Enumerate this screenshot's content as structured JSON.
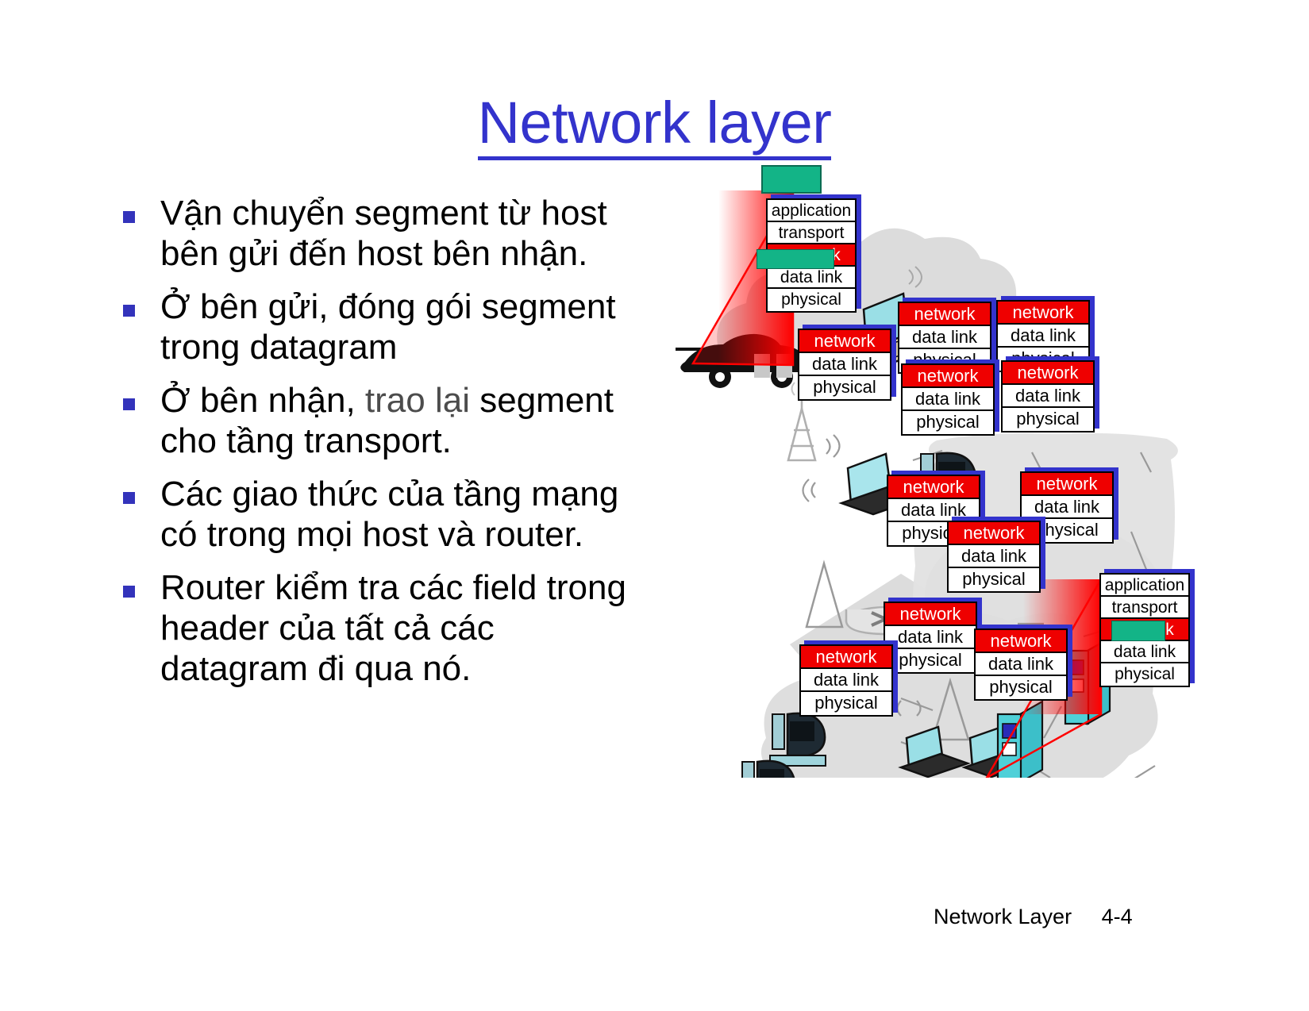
{
  "slide": {
    "title": "Network layer",
    "footer_label": "Network Layer",
    "footer_page": "4-4"
  },
  "bullets": [
    {
      "text": "Vận chuyển segment từ host bên gửi đến host bên nhận."
    },
    {
      "text": "Ở bên gửi, đóng gói segment trong datagram"
    },
    {
      "text": "Ở bên nhận, ",
      "text2": "trao lại",
      "text3": " segment cho tầng transport."
    },
    {
      "text": "Các giao thức của tầng mạng có trong mọi host và router."
    },
    {
      "text": "Router kiểm tra các field trong header của tất cả các datagram đi qua nó."
    }
  ],
  "diagram": {
    "labels": {
      "application": "application",
      "transport": "transport",
      "network": "network",
      "data_link": "data link",
      "physical": "physical"
    },
    "colors": {
      "network_row": "#ef0000",
      "stack_shadow": "#3333cc",
      "green_overlay": "#13b487",
      "cloud": "#dcdcdc",
      "title_blue": "#3333cc",
      "bullet_marker": "#3333bb"
    },
    "host_stacks": [
      {
        "name": "sender-host-stack",
        "rows": [
          "application",
          "transport",
          "network",
          "data link",
          "physical"
        ]
      },
      {
        "name": "receiver-host-stack",
        "rows": [
          "application",
          "transport",
          "network",
          "data link",
          "physical"
        ]
      }
    ],
    "router_stacks": [
      {
        "name": "router-stack-1",
        "rows": [
          "network",
          "data link",
          "physical"
        ]
      },
      {
        "name": "router-stack-2",
        "rows": [
          "network",
          "data link",
          "physical"
        ]
      },
      {
        "name": "router-stack-3",
        "rows": [
          "network",
          "data link",
          "physical"
        ]
      },
      {
        "name": "router-stack-4",
        "rows": [
          "network",
          "data link",
          "physical"
        ]
      },
      {
        "name": "router-stack-5",
        "rows": [
          "network",
          "data link",
          "physical"
        ]
      },
      {
        "name": "router-stack-6",
        "rows": [
          "network",
          "data link",
          "physical"
        ]
      },
      {
        "name": "router-stack-7",
        "rows": [
          "network",
          "data link",
          "physical"
        ]
      },
      {
        "name": "router-stack-8",
        "rows": [
          "network",
          "data link",
          "physical"
        ]
      },
      {
        "name": "router-stack-9",
        "rows": [
          "network",
          "data link",
          "physical"
        ]
      },
      {
        "name": "router-stack-10",
        "rows": [
          "network",
          "data link",
          "physical"
        ]
      },
      {
        "name": "router-stack-11",
        "rows": [
          "network",
          "data link",
          "physical"
        ]
      }
    ]
  }
}
